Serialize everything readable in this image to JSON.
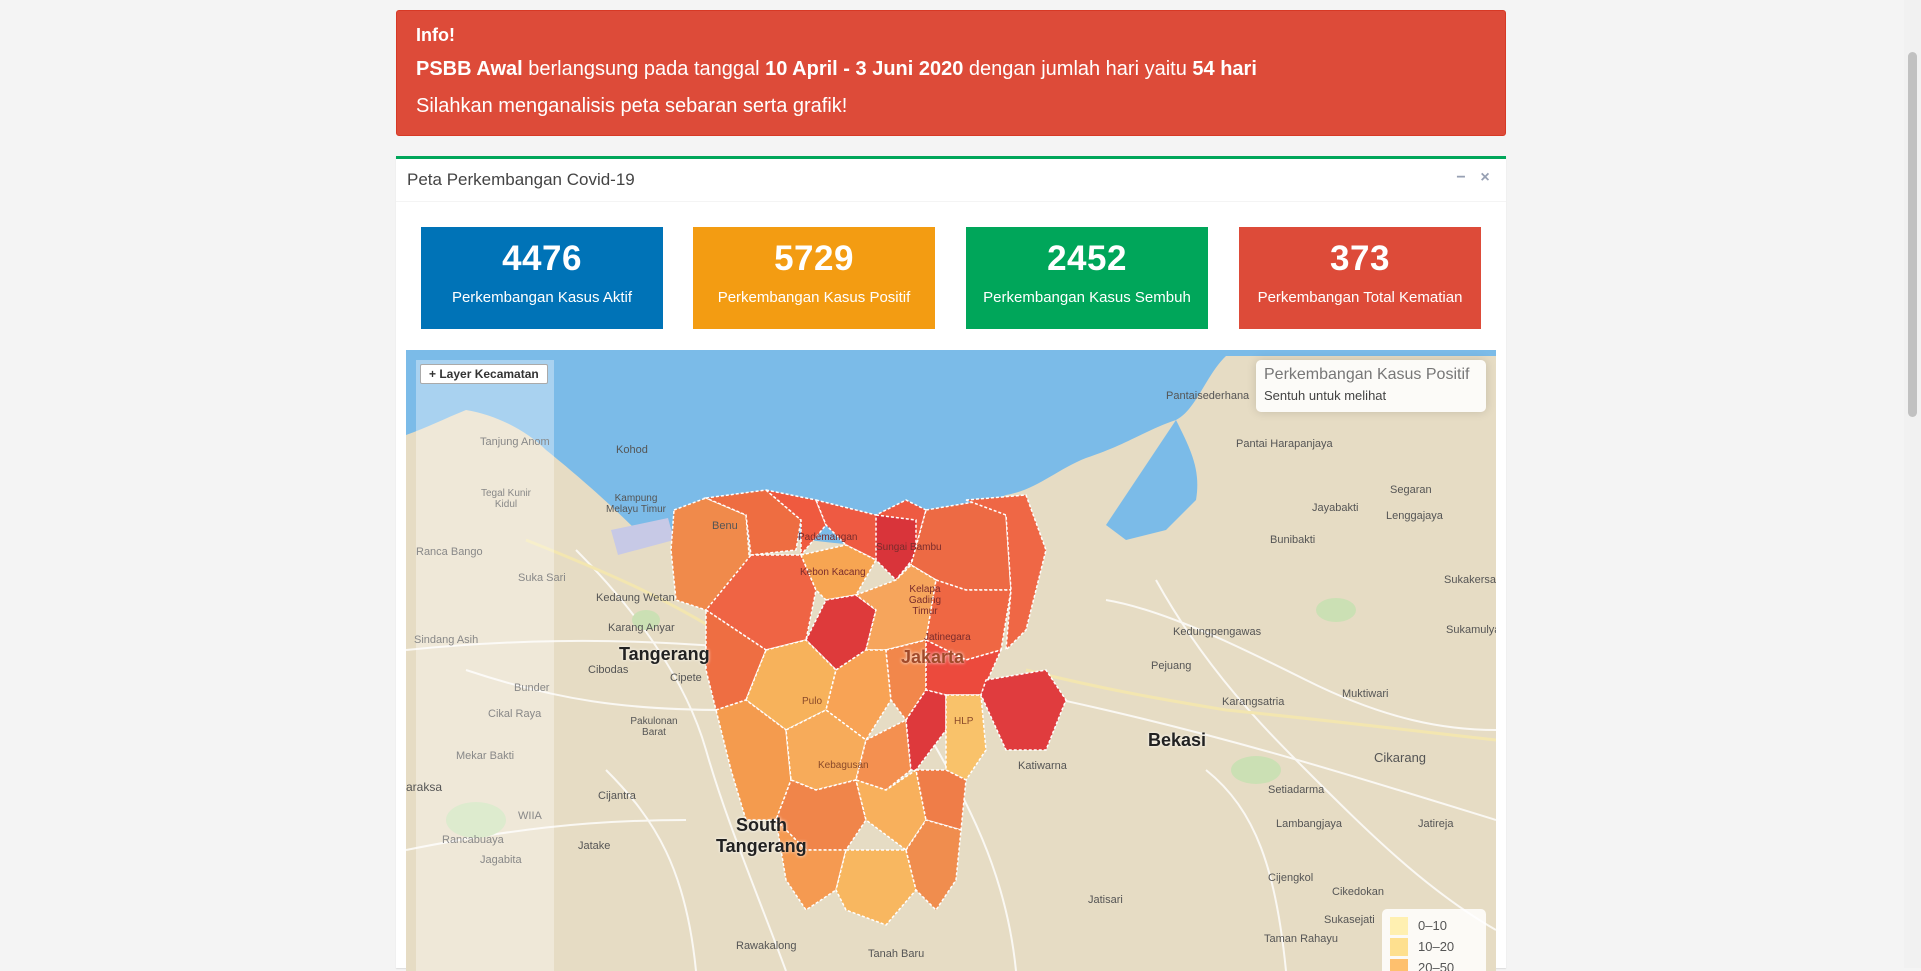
{
  "alert": {
    "title": "Info!",
    "phase": "PSBB Awal",
    "text_a": " berlangsung pada tanggal ",
    "dates": "10 April - 3 Juni 2020",
    "text_b": " dengan jumlah hari yaitu ",
    "days": "54 hari",
    "line2": "Silahkan menganalisis peta sebaran serta grafik!"
  },
  "box": {
    "title": "Peta Perkembangan Covid-19",
    "minimize_icon": "−",
    "close_icon": "×"
  },
  "stats": [
    {
      "value": "4476",
      "label": "Perkembangan Kasus Aktif",
      "color": "#0073b7"
    },
    {
      "value": "5729",
      "label": "Perkembangan Kasus Positif",
      "color": "#f39c12"
    },
    {
      "value": "2452",
      "label": "Perkembangan Kasus Sembuh",
      "color": "#00a65a"
    },
    {
      "value": "373",
      "label": "Perkembangan Total Kematian",
      "color": "#dd4b39"
    }
  ],
  "map": {
    "layer_button": "+ Layer Kecamatan",
    "info_title": "Perkembangan Kasus Positif",
    "info_subtitle": "Sentuh untuk melihat",
    "legend": [
      {
        "label": "0–10",
        "color": "#ffeda0"
      },
      {
        "label": "10–20",
        "color": "#fed976"
      },
      {
        "label": "20–50",
        "color": "#feb24c"
      }
    ],
    "cities": [
      "Tangerang",
      "Jakarta",
      "Bekasi",
      "South",
      "Tangerang"
    ],
    "places": [
      "Pantaisederhana",
      "Pantai Harapanjaya",
      "Segaran",
      "Jayabakti",
      "Lenggajaya",
      "Bunibakti",
      "Sukakersa",
      "Sukamulya",
      "Kedungpengawas",
      "Pejuang",
      "Karangsatria",
      "Muktiwari",
      "Cikarang",
      "Setiadarma",
      "Lambangjaya",
      "Jatireja",
      "Cijengkol",
      "Cikedokan",
      "Sukasejati",
      "Taman Rahayu",
      "Jatisari",
      "Tanah Baru",
      "Rawakalong",
      "Kohod",
      "Kampung Melayu Timur",
      "Tanjung Anom",
      "Tegal Kunir Kidul",
      "Ranca Bango",
      "Suka Sari",
      "Kedaung Wetan",
      "Karang Anyar",
      "Sindang Asih",
      "Cibodas",
      "Cipete",
      "Bunder",
      "Cikal Raya",
      "Pakulonan Barat",
      "Mekar Bakti",
      "araksa",
      "Cijantra",
      "WIIA",
      "Jatake",
      "Rancabuaya",
      "Jagabita",
      "Sungai Bambu",
      "Kelapa Gading Timur",
      "Jatinegara",
      "Kebon Kacang",
      "Pulo",
      "Kebagusan",
      "HLP",
      "Katiwarna",
      "Pademangan",
      "Benu"
    ]
  }
}
